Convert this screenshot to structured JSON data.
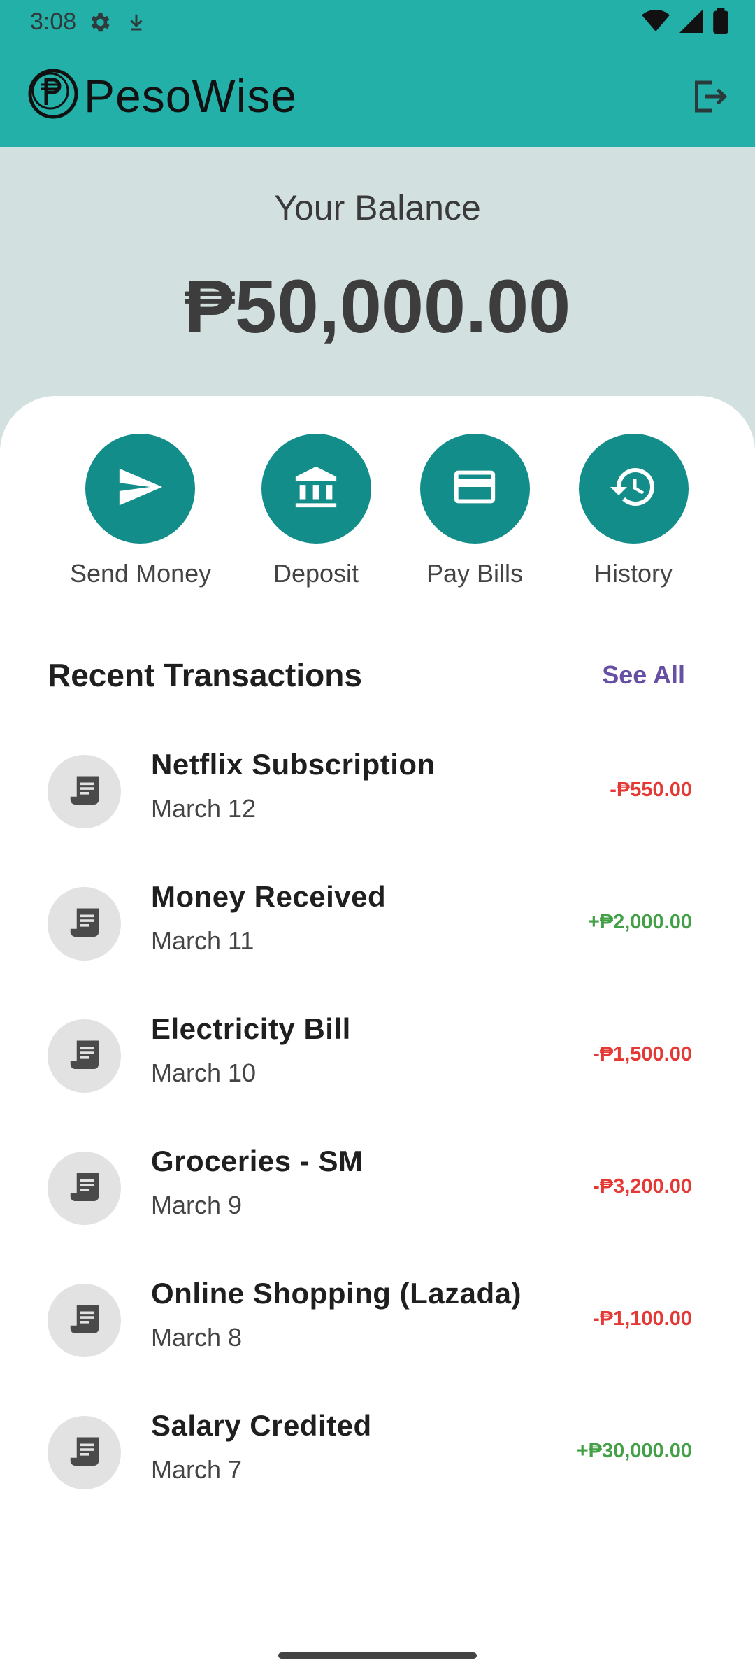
{
  "status_bar": {
    "time": "3:08",
    "icons": [
      "gear-icon",
      "download-arrow-icon",
      "wifi-icon",
      "signal-icon",
      "battery-icon"
    ]
  },
  "app": {
    "name": "PesoWise",
    "logo_icon": "peso-coin-icon",
    "logout_icon": "logout-icon"
  },
  "balance": {
    "title": "Your Balance",
    "amount": "₱50,000.00"
  },
  "actions": [
    {
      "label": "Send Money",
      "icon": "send-icon"
    },
    {
      "label": "Deposit",
      "icon": "bank-icon"
    },
    {
      "label": "Pay Bills",
      "icon": "card-icon"
    },
    {
      "label": "History",
      "icon": "history-icon"
    }
  ],
  "transactions_section": {
    "title": "Recent Transactions",
    "see_all": "See All",
    "items": [
      {
        "name": "Netflix Subscription",
        "date": "March 12",
        "amount": "-₱550.00",
        "type": "debit"
      },
      {
        "name": "Money Received",
        "date": "March 11",
        "amount": "+₱2,000.00",
        "type": "credit"
      },
      {
        "name": "Electricity Bill",
        "date": "March 10",
        "amount": "-₱1,500.00",
        "type": "debit"
      },
      {
        "name": "Groceries - SM",
        "date": "March 9",
        "amount": "-₱3,200.00",
        "type": "debit"
      },
      {
        "name": "Online Shopping (Lazada)",
        "date": "March 8",
        "amount": "-₱1,100.00",
        "type": "debit"
      },
      {
        "name": "Salary Credited",
        "date": "March 7",
        "amount": "+₱30,000.00",
        "type": "credit"
      }
    ]
  },
  "colors": {
    "header": "#22b0a9",
    "accent": "#138d8a",
    "background": "#d2e0df",
    "debit": "#e53935",
    "credit": "#43a047",
    "link": "#6750a4"
  }
}
